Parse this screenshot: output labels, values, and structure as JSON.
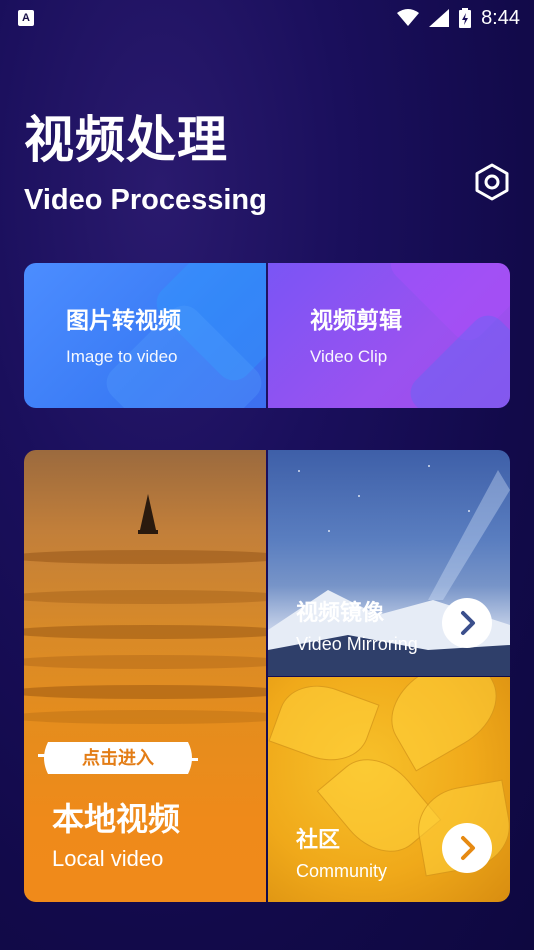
{
  "status_bar": {
    "time": "8:44",
    "app_icon": "A"
  },
  "header": {
    "title_cn": "视频处理",
    "title_en": "Video Processing",
    "settings_icon": "settings-hex-icon"
  },
  "tools": [
    {
      "title_cn": "图片转视频",
      "title_en": "Image to video",
      "color": "#3f7ef5"
    },
    {
      "title_cn": "视频剪辑",
      "title_en": "Video Clip",
      "color": "#9352ef"
    }
  ],
  "local_video": {
    "badge": "点击进入",
    "title_cn": "本地视频",
    "title_en": "Local video",
    "color": "#ef8a1a"
  },
  "mirroring": {
    "title_cn": "视频镜像",
    "title_en": "Video Mirroring",
    "arrow_icon": "chevron-right-icon"
  },
  "community": {
    "title_cn": "社区",
    "title_en": "Community",
    "arrow_icon": "chevron-right-icon"
  }
}
